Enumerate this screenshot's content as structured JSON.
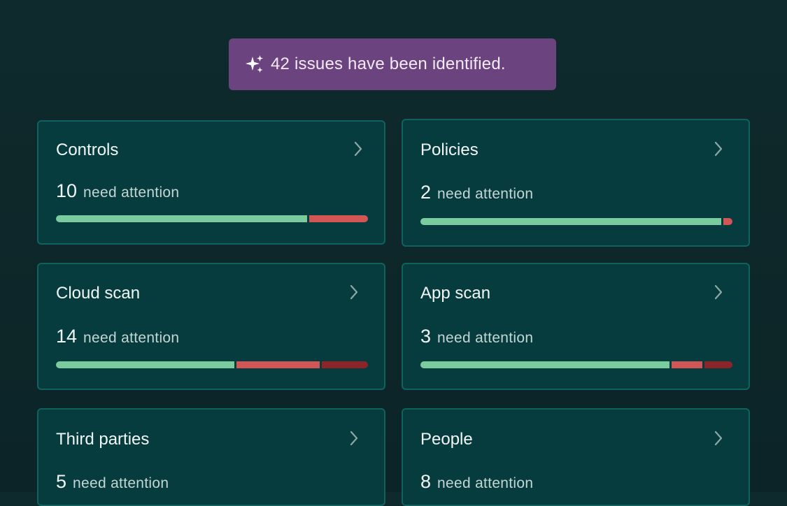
{
  "banner": {
    "icon": "sparkles-icon",
    "text": "42 issues have been identified."
  },
  "colors": {
    "background": "#0f2a2c",
    "banner": "#6b437e",
    "card": "#063c3e",
    "card_border": "#10625f",
    "ok": "#7acc9f",
    "warning": "#d25656",
    "critical": "#8d2528"
  },
  "cards": [
    {
      "title": "Controls",
      "count": "10",
      "label": "need attention",
      "progress": {
        "ok": 81,
        "warning": 19,
        "critical": 0
      }
    },
    {
      "title": "Policies",
      "count": "2",
      "label": "need attention",
      "progress": {
        "ok": 97,
        "warning": 3,
        "critical": 0
      }
    },
    {
      "title": "Cloud scan",
      "count": "14",
      "label": "need attention",
      "progress": {
        "ok": 58,
        "warning": 27,
        "critical": 15
      }
    },
    {
      "title": "App scan",
      "count": "3",
      "label": "need attention",
      "progress": {
        "ok": 81,
        "warning": 10,
        "critical": 9
      }
    },
    {
      "title": "Third parties",
      "count": "5",
      "label": "need attention"
    },
    {
      "title": "People",
      "count": "8",
      "label": "need attention"
    }
  ]
}
